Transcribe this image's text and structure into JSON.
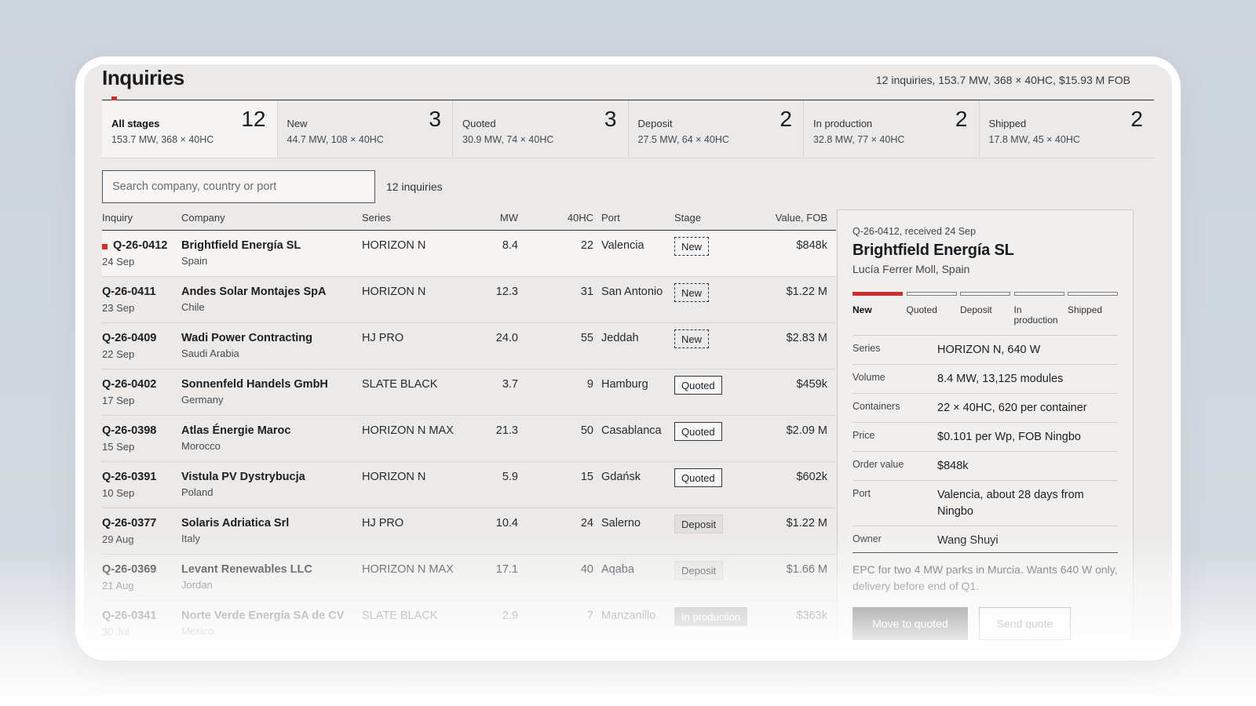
{
  "page": {
    "title": "Inquiries",
    "summary": "12 inquiries, 153.7 MW, 368 × 40HC, $15.93 M FOB"
  },
  "tabs": [
    {
      "label": "All stages",
      "count": "12",
      "sub": "153.7 MW, 368 × 40HC",
      "active": true
    },
    {
      "label": "New",
      "count": "3",
      "sub": "44.7 MW, 108 × 40HC"
    },
    {
      "label": "Quoted",
      "count": "3",
      "sub": "30.9 MW, 74 × 40HC"
    },
    {
      "label": "Deposit",
      "count": "2",
      "sub": "27.5 MW, 64 × 40HC"
    },
    {
      "label": "In production",
      "count": "2",
      "sub": "32.8 MW, 77 × 40HC"
    },
    {
      "label": "Shipped",
      "count": "2",
      "sub": "17.8 MW, 45 × 40HC"
    }
  ],
  "search": {
    "placeholder": "Search company, country or port",
    "count_label": "12 inquiries"
  },
  "table": {
    "headers": {
      "inquiry": "Inquiry",
      "company": "Company",
      "series": "Series",
      "mw": "MW",
      "hc": "40HC",
      "port": "Port",
      "stage": "Stage",
      "value": "Value, FOB"
    },
    "rows": [
      {
        "id": "Q-26-0412",
        "date": "24 Sep",
        "company": "Brightfield Energía SL",
        "country": "Spain",
        "series": "HORIZON N",
        "mw": "8.4",
        "hc": "22",
        "port": "Valencia",
        "stage": "New",
        "value": "$848k"
      },
      {
        "id": "Q-26-0411",
        "date": "23 Sep",
        "company": "Andes Solar Montajes SpA",
        "country": "Chile",
        "series": "HORIZON N",
        "mw": "12.3",
        "hc": "31",
        "port": "San Antonio",
        "stage": "New",
        "value": "$1.22 M"
      },
      {
        "id": "Q-26-0409",
        "date": "22 Sep",
        "company": "Wadi Power Contracting",
        "country": "Saudi Arabia",
        "series": "HJ PRO",
        "mw": "24.0",
        "hc": "55",
        "port": "Jeddah",
        "stage": "New",
        "value": "$2.83 M"
      },
      {
        "id": "Q-26-0402",
        "date": "17 Sep",
        "company": "Sonnenfeld Handels GmbH",
        "country": "Germany",
        "series": "SLATE BLACK",
        "mw": "3.7",
        "hc": "9",
        "port": "Hamburg",
        "stage": "Quoted",
        "value": "$459k"
      },
      {
        "id": "Q-26-0398",
        "date": "15 Sep",
        "company": "Atlas Énergie Maroc",
        "country": "Morocco",
        "series": "HORIZON N MAX",
        "mw": "21.3",
        "hc": "50",
        "port": "Casablanca",
        "stage": "Quoted",
        "value": "$2.09 M"
      },
      {
        "id": "Q-26-0391",
        "date": "10 Sep",
        "company": "Vistula PV Dystrybucja",
        "country": "Poland",
        "series": "HORIZON N",
        "mw": "5.9",
        "hc": "15",
        "port": "Gdańsk",
        "stage": "Quoted",
        "value": "$602k"
      },
      {
        "id": "Q-26-0377",
        "date": "29 Aug",
        "company": "Solaris Adriatica Srl",
        "country": "Italy",
        "series": "HJ PRO",
        "mw": "10.4",
        "hc": "24",
        "port": "Salerno",
        "stage": "Deposit",
        "value": "$1.22 M"
      },
      {
        "id": "Q-26-0369",
        "date": "21 Aug",
        "company": "Levant Renewables LLC",
        "country": "Jordan",
        "series": "HORIZON N MAX",
        "mw": "17.1",
        "hc": "40",
        "port": "Aqaba",
        "stage": "Deposit",
        "value": "$1.66 M"
      },
      {
        "id": "Q-26-0341",
        "date": "30 Jul",
        "company": "Norte Verde Energía SA de CV",
        "country": "Mexico",
        "series": "SLATE BLACK",
        "mw": "2.9",
        "hc": "7",
        "port": "Manzanillo",
        "stage": "In production",
        "value": "$363k"
      }
    ]
  },
  "detail": {
    "ref": "Q-26-0412, received 24 Sep",
    "company": "Brightfield Energía SL",
    "contact": "Lucía Ferrer Moll, Spain",
    "stages": [
      "New",
      "Quoted",
      "Deposit",
      "In production",
      "Shipped"
    ],
    "current_stage": "New",
    "fields": [
      {
        "k": "Series",
        "v": "HORIZON N, 640 W"
      },
      {
        "k": "Volume",
        "v": "8.4 MW, 13,125 modules"
      },
      {
        "k": "Containers",
        "v": "22 × 40HC, 620 per container"
      },
      {
        "k": "Price",
        "v": "$0.101 per Wp, FOB Ningbo"
      },
      {
        "k": "Order value",
        "v": "$848k"
      },
      {
        "k": "Port",
        "v": "Valencia, about 28 days from Ningbo"
      },
      {
        "k": "Owner",
        "v": "Wang Shuyi"
      }
    ],
    "note": "EPC for two 4 MW parks in Murcia. Wants 640 W only, delivery before end of Q1.",
    "primary_button": "Move to quoted",
    "secondary_button": "Send quote"
  },
  "colors": {
    "accent": "#c8312c",
    "window_bg": "#ebeae8",
    "page_bg": "#cdd5dd"
  }
}
